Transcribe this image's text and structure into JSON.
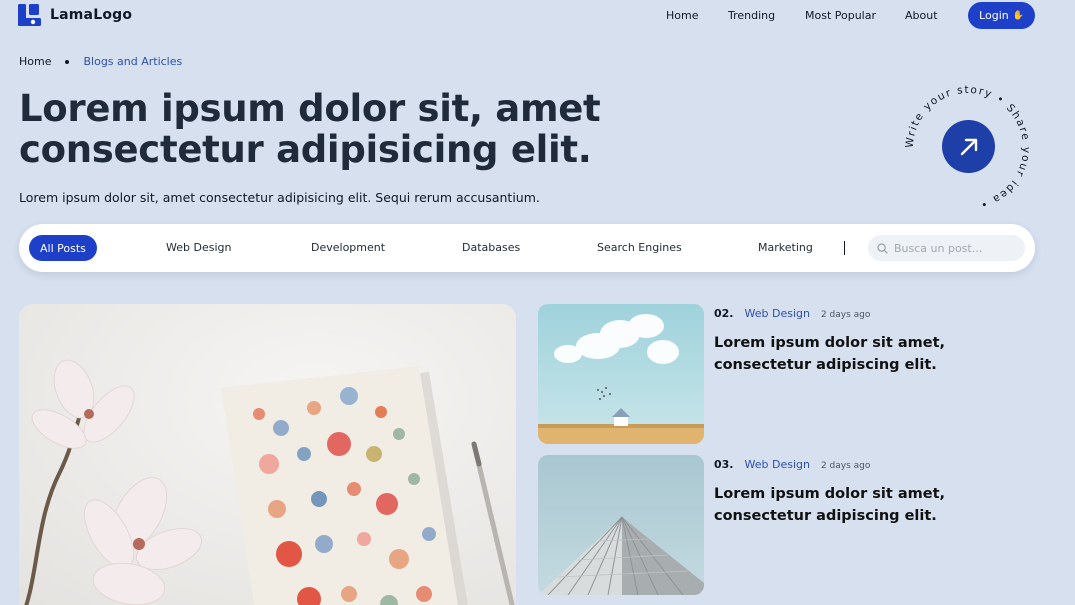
{
  "brand": {
    "name": "LamaLogo"
  },
  "nav": {
    "links": [
      "Home",
      "Trending",
      "Most Popular",
      "About"
    ],
    "login_label": "Login",
    "login_icon": "waving-hand-icon"
  },
  "breadcrumb": {
    "home": "Home",
    "current": "Blogs and Articles"
  },
  "hero": {
    "title": "Lorem ipsum dolor sit, amet consectetur adipisicing elit.",
    "subtitle": "Lorem ipsum dolor sit, amet consectetur adipisicing elit. Sequi rerum accusantium.",
    "badge_text": "Write your story • Share your idea •",
    "badge_icon": "arrow-up-right-icon"
  },
  "filters": {
    "categories": [
      "All Posts",
      "Web Design",
      "Development",
      "Databases",
      "Search Engines",
      "Marketing"
    ],
    "active": "All Posts",
    "search_placeholder": "Busca un post..."
  },
  "featured": {
    "image": "notebook-and-magnolia-photo"
  },
  "posts": [
    {
      "number": "02.",
      "category": "Web Design",
      "date": "2 days ago",
      "title": "Lorem ipsum dolor sit amet, consectetur adipiscing elit.",
      "image": "field-house-photo"
    },
    {
      "number": "03.",
      "category": "Web Design",
      "date": "2 days ago",
      "title": "Lorem ipsum dolor sit amet, consectetur adipiscing elit.",
      "image": "building-photo"
    }
  ],
  "colors": {
    "background": "#d6e0ee",
    "accent": "#1e40c8",
    "link": "#2e4fb0"
  }
}
